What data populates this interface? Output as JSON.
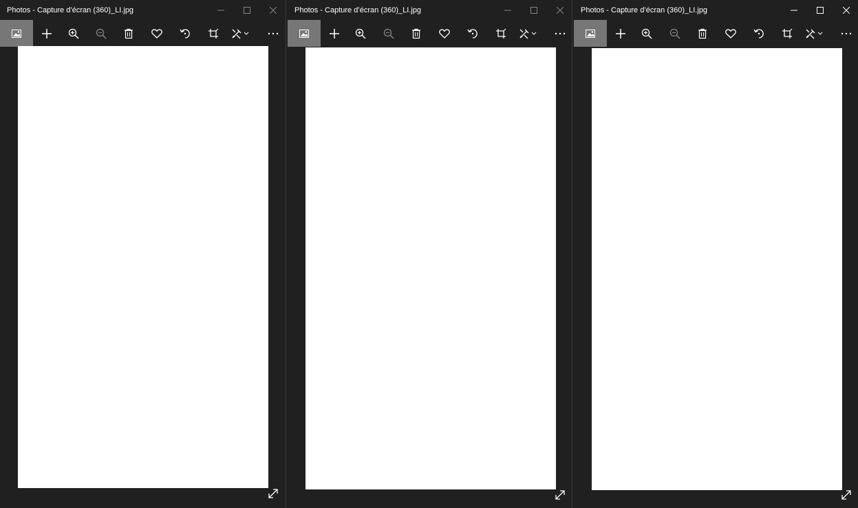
{
  "windows": [
    {
      "title": "Photos - Capture d’écran (360)_LI.jpg",
      "state": "inactive"
    },
    {
      "title": "Photos - Capture d’écran (360)_LI.jpg",
      "state": "inactive"
    },
    {
      "title": "Photos - Capture d’écran (360)_LI.jpg",
      "state": "active"
    }
  ],
  "toolbar_icons": [
    "image-icon",
    "add-icon",
    "zoom-in-icon",
    "zoom-out-icon",
    "delete-icon",
    "favorite-icon",
    "rotate-icon",
    "crop-icon",
    "edit-icon",
    "more-icon"
  ],
  "colors": {
    "background": "#202020",
    "active_tool": "#777777",
    "image": "#ffffff"
  }
}
